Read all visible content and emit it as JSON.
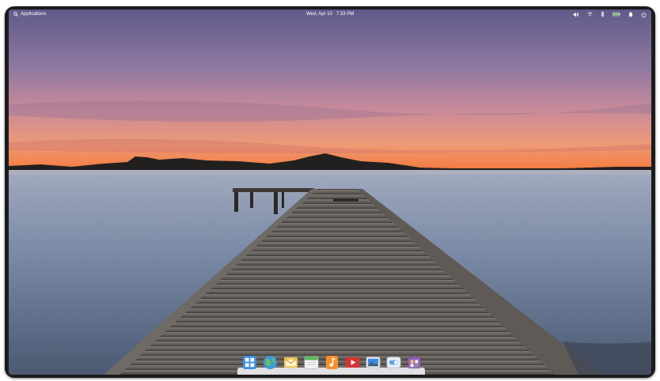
{
  "panel": {
    "applications_label": "Applications",
    "date": "Wed, Apr 10",
    "time": "7:33 PM",
    "indicators": [
      {
        "icon": "volume-icon"
      },
      {
        "icon": "wifi-icon"
      },
      {
        "icon": "bluetooth-icon"
      },
      {
        "icon": "battery-icon"
      },
      {
        "icon": "notifications-bell-icon"
      },
      {
        "icon": "power-icon"
      }
    ]
  },
  "dock": {
    "items": [
      {
        "icon": "multitasking-view-icon",
        "color": "#3d8fe0"
      },
      {
        "icon": "web-browser-icon",
        "color": "#3b9bd8"
      },
      {
        "icon": "mail-icon",
        "color": "#f0c34a"
      },
      {
        "icon": "calendar-icon",
        "color": "#5fb85f"
      },
      {
        "icon": "music-icon",
        "color": "#f5902c"
      },
      {
        "icon": "videos-icon",
        "color": "#d93434"
      },
      {
        "icon": "photos-icon",
        "color": "#3a8de0"
      },
      {
        "icon": "settings-toggle-icon",
        "color": "#5fa7e8"
      },
      {
        "icon": "appcenter-icon",
        "color": "#9b5fc7"
      }
    ]
  },
  "colors": {
    "sky_top": "#6e6595",
    "sky_horizon": "#f07a4a",
    "water": "#8795ad",
    "pier": "#5b5550"
  }
}
